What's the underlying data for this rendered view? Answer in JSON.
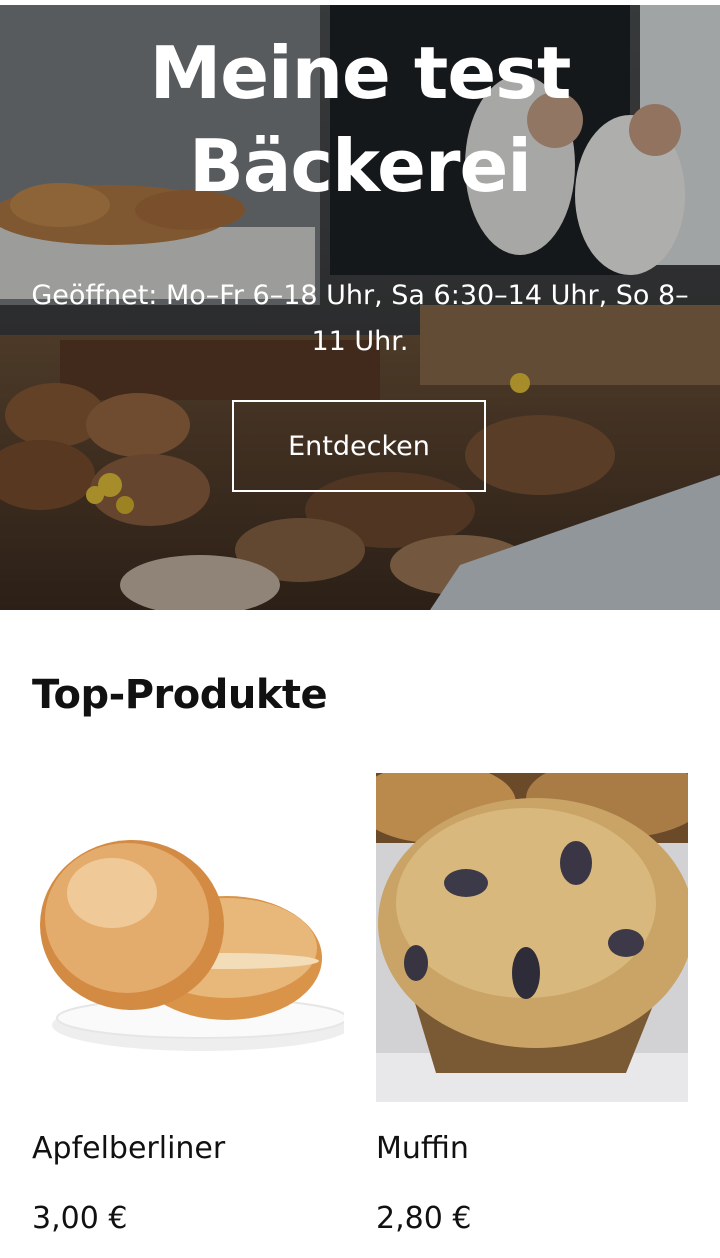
{
  "hero": {
    "title": "Meine test Bäckerei",
    "hours": "Geöffnet: Mo–Fr 6–18 Uhr, Sa 6:30–14 Uhr, So 8–11 Uhr.",
    "cta_label": "Entdecken"
  },
  "products_section": {
    "title": "Top-Produkte",
    "items": [
      {
        "name": "Apfelberliner",
        "price": "3,00 €",
        "image": "berliner-donuts-photo"
      },
      {
        "name": "Muffin",
        "price": "2,80 €",
        "image": "blueberry-muffin-photo"
      }
    ]
  },
  "colors": {
    "text": "#111111",
    "background": "#ffffff",
    "hero_text": "#ffffff"
  }
}
